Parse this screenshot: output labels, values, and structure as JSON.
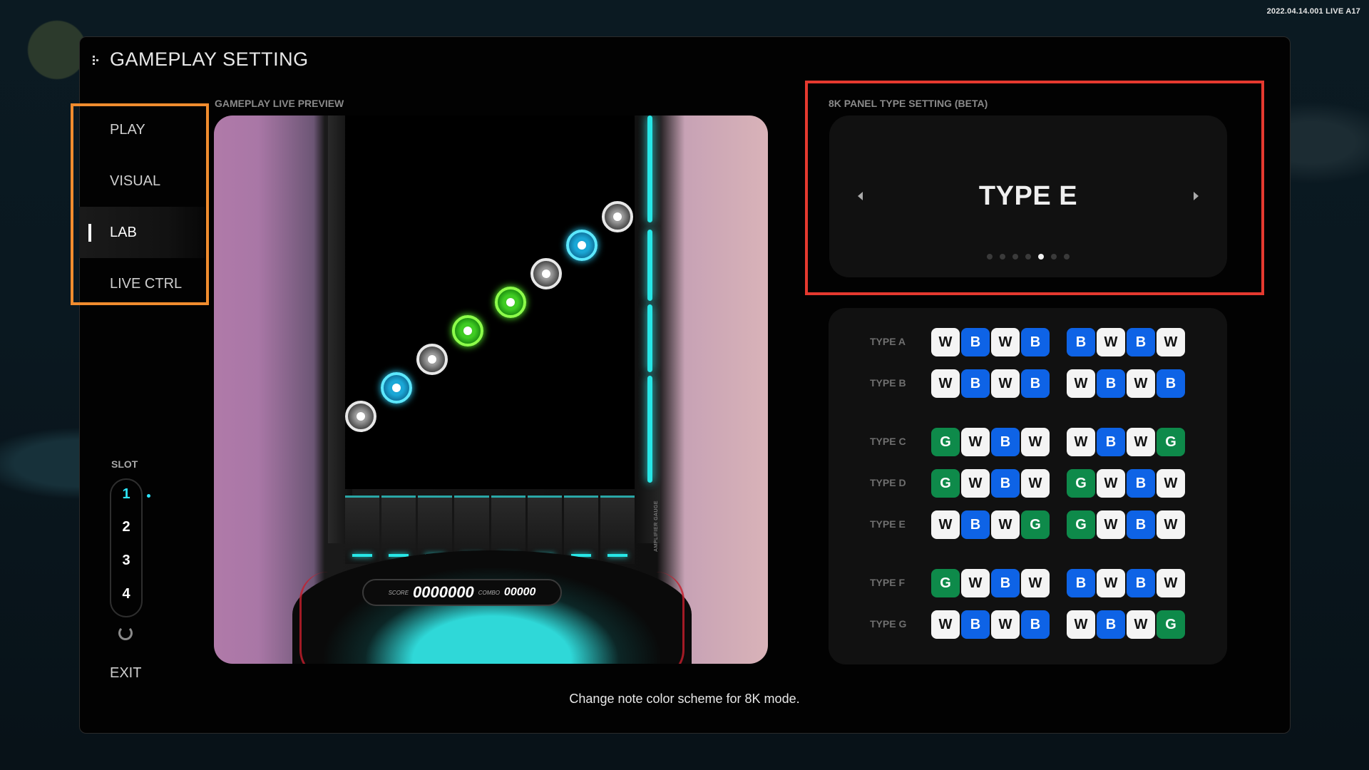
{
  "version": "2022.04.14.001 LIVE A17",
  "title": "GAMEPLAY SETTING",
  "nav": {
    "items": [
      {
        "label": "PLAY",
        "active": false
      },
      {
        "label": "VISUAL",
        "active": false
      },
      {
        "label": "LAB",
        "active": true
      },
      {
        "label": "LIVE CTRL",
        "active": false
      }
    ]
  },
  "slot": {
    "label": "SLOT",
    "numbers": [
      "1",
      "2",
      "3",
      "4"
    ],
    "active": "1"
  },
  "exit_label": "EXIT",
  "preview": {
    "label": "GAMEPLAY LIVE PREVIEW",
    "score_label": "SCORE",
    "score_value": "0000000",
    "combo_label": "COMBO",
    "combo_value": "00000",
    "side_text": "AMPLIFIER GAUGE",
    "icons": [
      "note-white-icon",
      "note-cyan-icon",
      "note-green-icon"
    ]
  },
  "panel_setting": {
    "label": "8K PANEL TYPE SETTING (BETA)",
    "value": "TYPE E",
    "page_count": 7,
    "page_index": 4
  },
  "types": [
    {
      "label": "TYPE A",
      "left": [
        "W",
        "B",
        "W",
        "B"
      ],
      "right": [
        "B",
        "W",
        "B",
        "W"
      ]
    },
    {
      "label": "TYPE B",
      "left": [
        "W",
        "B",
        "W",
        "B"
      ],
      "right": [
        "W",
        "B",
        "W",
        "B"
      ]
    },
    {
      "label": "TYPE C",
      "left": [
        "G",
        "W",
        "B",
        "W"
      ],
      "right": [
        "W",
        "B",
        "W",
        "G"
      ]
    },
    {
      "label": "TYPE D",
      "left": [
        "G",
        "W",
        "B",
        "W"
      ],
      "right": [
        "G",
        "W",
        "B",
        "W"
      ]
    },
    {
      "label": "TYPE E",
      "left": [
        "W",
        "B",
        "W",
        "G"
      ],
      "right": [
        "G",
        "W",
        "B",
        "W"
      ]
    },
    {
      "label": "TYPE F",
      "left": [
        "G",
        "W",
        "B",
        "W"
      ],
      "right": [
        "B",
        "W",
        "B",
        "W"
      ]
    },
    {
      "label": "TYPE G",
      "left": [
        "W",
        "B",
        "W",
        "B"
      ],
      "right": [
        "W",
        "B",
        "W",
        "G"
      ]
    }
  ],
  "hint": "Change note color scheme for 8K mode.",
  "colors": {
    "accent_cyan": "#2ee6ff",
    "key_white": "#f4f4f4",
    "key_blue": "#0e63e6",
    "key_green": "#0e8a4a",
    "highlight_orange": "#f08c2e",
    "highlight_red": "#e5392f"
  }
}
